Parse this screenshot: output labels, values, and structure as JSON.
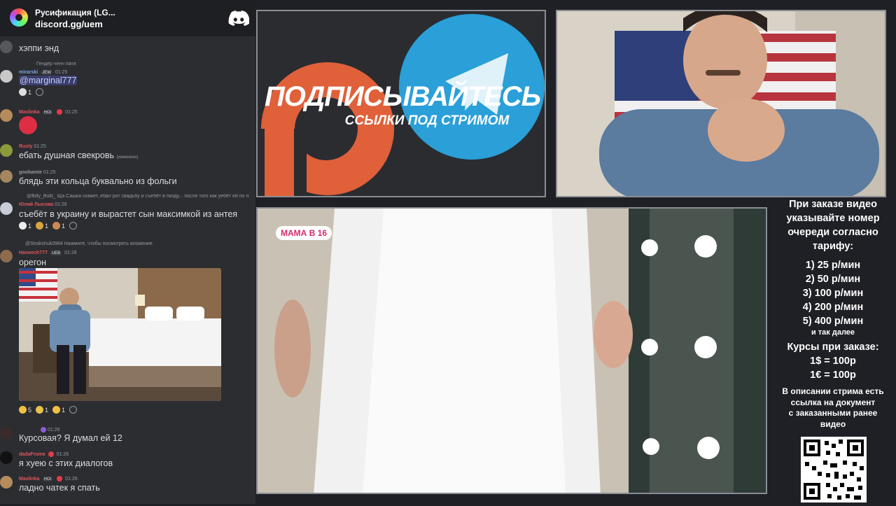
{
  "server": {
    "name": "Русификация (LG...",
    "invite": "discord.gg/uem"
  },
  "messages": [
    {
      "text": "хэппи энд"
    },
    {
      "reply": "Гендер ченч пати",
      "author": "mirarski",
      "tags": [
        "JEW"
      ],
      "time": "01:25",
      "mention": "@marginal777",
      "reactions": [
        {
          "count": "1"
        }
      ]
    },
    {
      "author": "Maslinka",
      "tags": [
        "HOI"
      ],
      "time": "01:25"
    },
    {
      "author": "Rusty",
      "time": "01:25",
      "text": "ебать душная свекровь",
      "edited": "(изменено)"
    },
    {
      "author": "goobamie",
      "time": "01:25",
      "text": "блядь эти кольца буквально из фольги"
    },
    {
      "reply": "@Billy_Bulb_ Ща Сашка скажет, ебал рот свадьбу и съебёт в пизду... после того как уебёт ей по л",
      "author": "Юлий Лысова",
      "time": "01:26",
      "text": "съебёт в украину и вырастет сын максимкой из антея",
      "reactions": [
        {
          "count": "1"
        },
        {
          "count": "1"
        },
        {
          "count": "1"
        }
      ]
    },
    {
      "reply": "@Strakshuk0984 Нажмите, чтобы посмотреть вложение",
      "author": "Haneech777",
      "tags": [
        "UEB"
      ],
      "time": "01:26",
      "text": "орегон",
      "reactions": [
        {
          "count": "5"
        },
        {
          "count": "1"
        },
        {
          "count": "1"
        }
      ]
    },
    {
      "time": "01:26",
      "text": "Курсовая? Я думал ей 12"
    },
    {
      "author": "dadaFrome",
      "time": "01:26",
      "text": "я хуею с этих диалогов"
    },
    {
      "author": "Maslinka",
      "tags": [
        "HOI"
      ],
      "time": "01:26",
      "text": "ладно чатек я спать"
    }
  ],
  "banner": {
    "title": "ПОДПИСЫВАЙТЕСЬ",
    "subtitle": "ССЫЛКИ ПОД СТРИМОМ"
  },
  "video": {
    "badge": "МАМА В 16"
  },
  "info": {
    "lines1": [
      "При заказе видео",
      "указывайте номер",
      "очереди согласно",
      "тарифу:"
    ],
    "tariffs": [
      "1) 25 р/мин",
      "2) 50 р/мин",
      "3) 100 р/мин",
      "4) 200 р/мин",
      "5) 400 р/мин"
    ],
    "etc": "и так далее",
    "rates_title": "Курсы при заказе:",
    "rates": [
      "1$ = 100р",
      "1€ = 100р"
    ],
    "doc_lines": [
      "В описании стрима есть",
      "ссылка на документ",
      "с заказанными ранее",
      "видео"
    ]
  },
  "colors": {
    "author_red": "#e0565c",
    "author_gold": "#d6a34a",
    "author_green": "#6fbf6a",
    "patreon": "#e0603a",
    "telegram": "#2a9fd8"
  }
}
